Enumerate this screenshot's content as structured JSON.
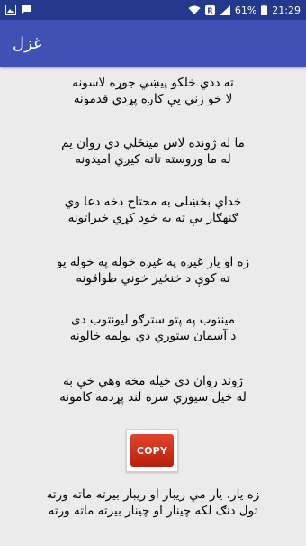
{
  "status_bar": {
    "battery_percent": "61%",
    "time": "21:29",
    "badge_letter": "R"
  },
  "app_bar": {
    "title": "غزل"
  },
  "poem": {
    "stanzas": [
      [
        "ته ددي خلكو پيښي جوړه لاسونه",
        "لا خو زني يې کاږه پړدي قدمونه"
      ],
      [
        "ما له ژونده لاس مينځلي دي روان يم",
        "له ما وروسته تاته کيږي اميدونه"
      ],
      [
        "خداي بخښلی به محتاج دخه دعا وي",
        "ګنهګار يې ته به خود کړي خيراتونه"
      ],
      [
        "زه او يار غيږه په غيږه خوله په خوله يو",
        "ته کوې د خنځير خوني طواقونه"
      ],
      [
        "مينتوب په پتو سترګو ليونتوب دی",
        "د آسمان ستوري دي بولمه خالونه"
      ],
      [
        "ژوند روان دی خيله مخه وهي خې به",
        "له خيل سيورې سره لند پړدمه کامونه"
      ],
      [
        "زه يار، يار مي ريبار او ريبار بيرته ماته ورته",
        "تول دنګ لکه چينار او چينار بيرته ماته ورته"
      ]
    ]
  },
  "copy_button": {
    "label": "COPY"
  }
}
